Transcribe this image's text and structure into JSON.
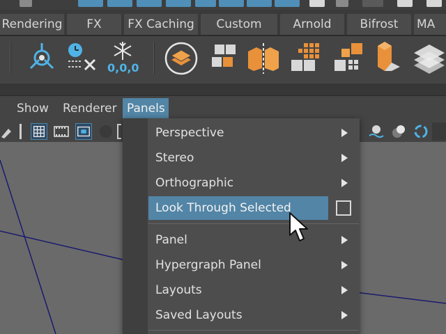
{
  "shelf_tabs": [
    {
      "label": "Rendering"
    },
    {
      "label": "FX"
    },
    {
      "label": "FX Caching"
    },
    {
      "label": "Custom"
    },
    {
      "label": "Arnold"
    },
    {
      "label": "Bifrost"
    },
    {
      "label": "MA"
    }
  ],
  "shelf_icons": [
    {
      "icon": "joint-tool-icon"
    },
    {
      "icon": "time-delete-icon"
    },
    {
      "icon": "freeze-transform-icon",
      "text": "0,0,0"
    },
    {
      "icon": "layer-stack-icon"
    },
    {
      "icon": "grid-blocks-icon"
    },
    {
      "icon": "symmetry-block-icon"
    },
    {
      "icon": "dot-grid-icon"
    },
    {
      "icon": "block-grid-icon"
    },
    {
      "icon": "tall-block-icon"
    },
    {
      "icon": "stacked-plates-icon"
    }
  ],
  "panel_menu": {
    "items": [
      {
        "label": "Show"
      },
      {
        "label": "Renderer"
      },
      {
        "label": "Panels"
      }
    ]
  },
  "dropdown": {
    "items": [
      {
        "label": "Perspective",
        "submenu": true
      },
      {
        "label": "Stereo",
        "submenu": true
      },
      {
        "label": "Orthographic",
        "submenu": true
      },
      {
        "label": "Look Through Selected",
        "submenu": false,
        "highlighted": true
      },
      {
        "label": "Panel",
        "submenu": true
      },
      {
        "label": "Hypergraph Panel",
        "submenu": true
      },
      {
        "label": "Layouts",
        "submenu": true
      },
      {
        "label": "Saved Layouts",
        "submenu": true
      }
    ]
  },
  "colors": {
    "accent": "#5285a6",
    "orange": "#e8913a",
    "icon_blue": "#4fb3e6"
  }
}
